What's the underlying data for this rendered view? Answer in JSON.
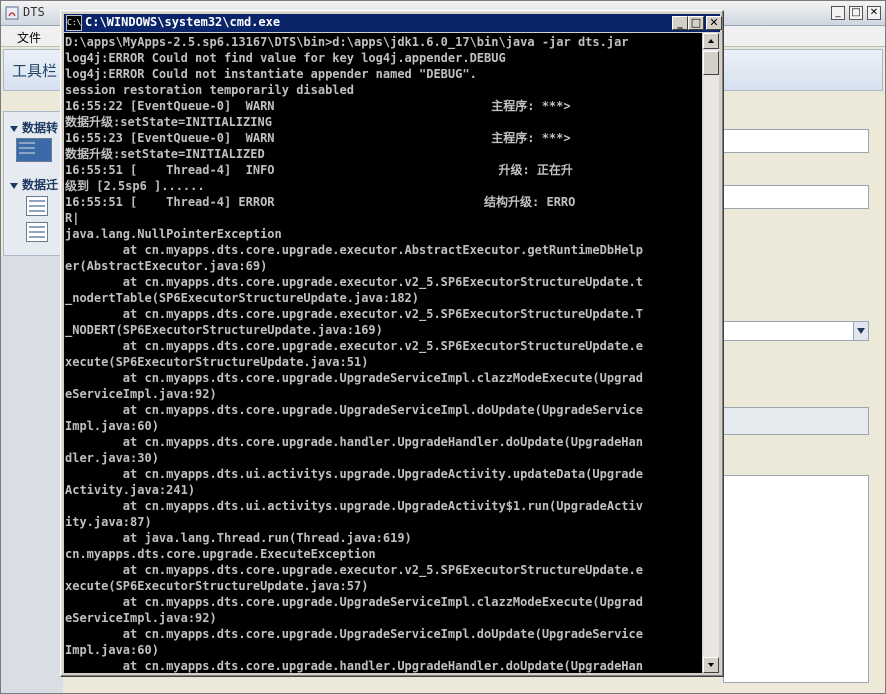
{
  "background_app": {
    "title": "DTS",
    "menu": {
      "file": "文件"
    },
    "toolbar_label": "工具栏",
    "sidebar": {
      "sections": [
        {
          "label": "数据转"
        },
        {
          "label": "数据迁"
        }
      ]
    },
    "window_controls": {
      "minimize": "_",
      "maximize": "□",
      "close": "✕"
    }
  },
  "console_window": {
    "title": "C:\\WINDOWS\\system32\\cmd.exe",
    "icon_label": "C:\\",
    "controls": {
      "minimize": "_",
      "maximize": "□",
      "close": "✕"
    },
    "lines": [
      "D:\\apps\\MyApps-2.5.sp6.13167\\DTS\\bin>d:\\apps\\jdk1.6.0_17\\bin\\java -jar dts.jar",
      "log4j:ERROR Could not find value for key log4j.appender.DEBUG",
      "log4j:ERROR Could not instantiate appender named \"DEBUG\".",
      "session restoration temporarily disabled",
      "16:55:22 [EventQueue-0]  WARN                              主程序: ***>",
      "数据升级:setState=INITIALIZING",
      "16:55:23 [EventQueue-0]  WARN                              主程序: ***>",
      "数据升级:setState=INITIALIZED",
      "16:55:51 [    Thread-4]  INFO                               升级: 正在升",
      "级到 [2.5sp6 ]......",
      "16:55:51 [    Thread-4] ERROR                             结构升级: ERRO",
      "R|",
      "java.lang.NullPointerException",
      "        at cn.myapps.dts.core.upgrade.executor.AbstractExecutor.getRuntimeDbHelp",
      "er(AbstractExecutor.java:69)",
      "        at cn.myapps.dts.core.upgrade.executor.v2_5.SP6ExecutorStructureUpdate.t",
      "_nodertTable(SP6ExecutorStructureUpdate.java:182)",
      "        at cn.myapps.dts.core.upgrade.executor.v2_5.SP6ExecutorStructureUpdate.T",
      "_NODERT(SP6ExecutorStructureUpdate.java:169)",
      "        at cn.myapps.dts.core.upgrade.executor.v2_5.SP6ExecutorStructureUpdate.e",
      "xecute(SP6ExecutorStructureUpdate.java:51)",
      "        at cn.myapps.dts.core.upgrade.UpgradeServiceImpl.clazzModeExecute(Upgrad",
      "eServiceImpl.java:92)",
      "        at cn.myapps.dts.core.upgrade.UpgradeServiceImpl.doUpdate(UpgradeService",
      "Impl.java:60)",
      "        at cn.myapps.dts.core.upgrade.handler.UpgradeHandler.doUpdate(UpgradeHan",
      "dler.java:30)",
      "        at cn.myapps.dts.ui.activitys.upgrade.UpgradeActivity.updateData(Upgrade",
      "Activity.java:241)",
      "        at cn.myapps.dts.ui.activitys.upgrade.UpgradeActivity$1.run(UpgradeActiv",
      "ity.java:87)",
      "        at java.lang.Thread.run(Thread.java:619)",
      "cn.myapps.dts.core.upgrade.ExecuteException",
      "        at cn.myapps.dts.core.upgrade.executor.v2_5.SP6ExecutorStructureUpdate.e",
      "xecute(SP6ExecutorStructureUpdate.java:57)",
      "        at cn.myapps.dts.core.upgrade.UpgradeServiceImpl.clazzModeExecute(Upgrad",
      "eServiceImpl.java:92)",
      "        at cn.myapps.dts.core.upgrade.UpgradeServiceImpl.doUpdate(UpgradeService",
      "Impl.java:60)",
      "        at cn.myapps.dts.core.upgrade.handler.UpgradeHandler.doUpdate(UpgradeHan"
    ]
  }
}
